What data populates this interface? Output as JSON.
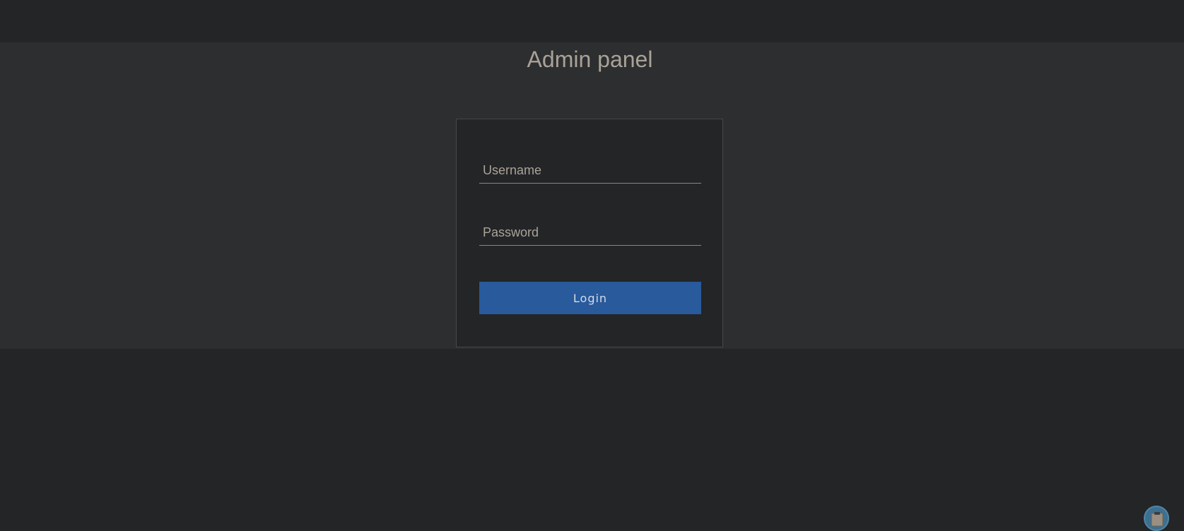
{
  "page": {
    "title": "Admin panel"
  },
  "login_form": {
    "username_placeholder": "Username",
    "username_value": "",
    "password_placeholder": "Password",
    "password_value": "",
    "login_label": "Login"
  },
  "floating_button": {
    "icon": "clipboard-icon"
  },
  "colors": {
    "background": "#242527",
    "band": "#2d2e30",
    "accent": "#285a9c",
    "title_text": "#aaa297"
  }
}
